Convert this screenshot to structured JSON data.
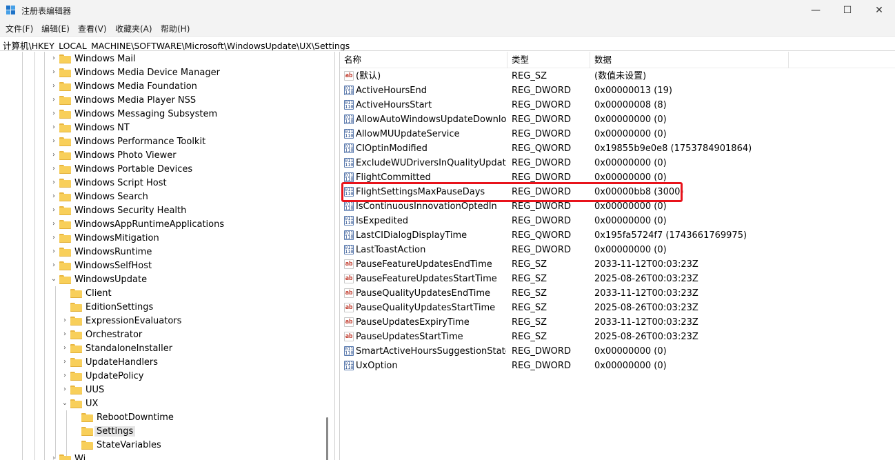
{
  "window": {
    "title": "注册表编辑器",
    "min_glyph": "—",
    "max_glyph": "☐",
    "close_glyph": "✕"
  },
  "menu": [
    "文件(F)",
    "编辑(E)",
    "查看(V)",
    "收藏夹(A)",
    "帮助(H)"
  ],
  "address": "计算机\\HKEY_LOCAL_MACHINE\\SOFTWARE\\Microsoft\\WindowsUpdate\\UX\\Settings",
  "tree": [
    {
      "label": "Windows Mail",
      "level": 0,
      "state": "collapsed"
    },
    {
      "label": "Windows Media Device Manager",
      "level": 0,
      "state": "collapsed"
    },
    {
      "label": "Windows Media Foundation",
      "level": 0,
      "state": "collapsed"
    },
    {
      "label": "Windows Media Player NSS",
      "level": 0,
      "state": "collapsed"
    },
    {
      "label": "Windows Messaging Subsystem",
      "level": 0,
      "state": "collapsed"
    },
    {
      "label": "Windows NT",
      "level": 0,
      "state": "collapsed"
    },
    {
      "label": "Windows Performance Toolkit",
      "level": 0,
      "state": "collapsed"
    },
    {
      "label": "Windows Photo Viewer",
      "level": 0,
      "state": "collapsed"
    },
    {
      "label": "Windows Portable Devices",
      "level": 0,
      "state": "collapsed"
    },
    {
      "label": "Windows Script Host",
      "level": 0,
      "state": "collapsed"
    },
    {
      "label": "Windows Search",
      "level": 0,
      "state": "collapsed"
    },
    {
      "label": "Windows Security Health",
      "level": 0,
      "state": "collapsed"
    },
    {
      "label": "WindowsAppRuntimeApplications",
      "level": 0,
      "state": "collapsed"
    },
    {
      "label": "WindowsMitigation",
      "level": 0,
      "state": "collapsed"
    },
    {
      "label": "WindowsRuntime",
      "level": 0,
      "state": "collapsed"
    },
    {
      "label": "WindowsSelfHost",
      "level": 0,
      "state": "collapsed"
    },
    {
      "label": "WindowsUpdate",
      "level": 0,
      "state": "expanded"
    },
    {
      "label": "Client",
      "level": 1,
      "state": "none"
    },
    {
      "label": "EditionSettings",
      "level": 1,
      "state": "none"
    },
    {
      "label": "ExpressionEvaluators",
      "level": 1,
      "state": "collapsed"
    },
    {
      "label": "Orchestrator",
      "level": 1,
      "state": "collapsed"
    },
    {
      "label": "StandaloneInstaller",
      "level": 1,
      "state": "collapsed"
    },
    {
      "label": "UpdateHandlers",
      "level": 1,
      "state": "collapsed"
    },
    {
      "label": "UpdatePolicy",
      "level": 1,
      "state": "collapsed"
    },
    {
      "label": "UUS",
      "level": 1,
      "state": "collapsed"
    },
    {
      "label": "UX",
      "level": 1,
      "state": "expanded"
    },
    {
      "label": "RebootDowntime",
      "level": 2,
      "state": "none"
    },
    {
      "label": "Settings",
      "level": 2,
      "state": "none",
      "selected": true
    },
    {
      "label": "StateVariables",
      "level": 2,
      "state": "none"
    },
    {
      "label": "Wi",
      "level": 0,
      "state": "collapsed"
    }
  ],
  "columns": {
    "name": "名称",
    "type": "类型",
    "data": "数据"
  },
  "values": [
    {
      "name": "(默认)",
      "type": "REG_SZ",
      "data": "(数值未设置)",
      "icon": "string"
    },
    {
      "name": "ActiveHoursEnd",
      "type": "REG_DWORD",
      "data": "0x00000013 (19)",
      "icon": "binary"
    },
    {
      "name": "ActiveHoursStart",
      "type": "REG_DWORD",
      "data": "0x00000008 (8)",
      "icon": "binary"
    },
    {
      "name": "AllowAutoWindowsUpdateDownloa...",
      "type": "REG_DWORD",
      "data": "0x00000000 (0)",
      "icon": "binary"
    },
    {
      "name": "AllowMUUpdateService",
      "type": "REG_DWORD",
      "data": "0x00000000 (0)",
      "icon": "binary"
    },
    {
      "name": "CIOptinModified",
      "type": "REG_QWORD",
      "data": "0x19855b9e0e8 (1753784901864)",
      "icon": "binary"
    },
    {
      "name": "ExcludeWUDriversInQualityUpdate",
      "type": "REG_DWORD",
      "data": "0x00000000 (0)",
      "icon": "binary"
    },
    {
      "name": "FlightCommitted",
      "type": "REG_DWORD",
      "data": "0x00000000 (0)",
      "icon": "binary"
    },
    {
      "name": "FlightSettingsMaxPauseDays",
      "type": "REG_DWORD",
      "data": "0x00000bb8 (3000)",
      "icon": "binary",
      "highlighted": true
    },
    {
      "name": "IsContinuousInnovationOptedIn",
      "type": "REG_DWORD",
      "data": "0x00000000 (0)",
      "icon": "binary"
    },
    {
      "name": "IsExpedited",
      "type": "REG_DWORD",
      "data": "0x00000000 (0)",
      "icon": "binary"
    },
    {
      "name": "LastCIDialogDisplayTime",
      "type": "REG_QWORD",
      "data": "0x195fa5724f7 (1743661769975)",
      "icon": "binary"
    },
    {
      "name": "LastToastAction",
      "type": "REG_DWORD",
      "data": "0x00000000 (0)",
      "icon": "binary"
    },
    {
      "name": "PauseFeatureUpdatesEndTime",
      "type": "REG_SZ",
      "data": "2033-11-12T00:03:23Z",
      "icon": "string"
    },
    {
      "name": "PauseFeatureUpdatesStartTime",
      "type": "REG_SZ",
      "data": "2025-08-26T00:03:23Z",
      "icon": "string"
    },
    {
      "name": "PauseQualityUpdatesEndTime",
      "type": "REG_SZ",
      "data": "2033-11-12T00:03:23Z",
      "icon": "string"
    },
    {
      "name": "PauseQualityUpdatesStartTime",
      "type": "REG_SZ",
      "data": "2025-08-26T00:03:23Z",
      "icon": "string"
    },
    {
      "name": "PauseUpdatesExpiryTime",
      "type": "REG_SZ",
      "data": "2033-11-12T00:03:23Z",
      "icon": "string"
    },
    {
      "name": "PauseUpdatesStartTime",
      "type": "REG_SZ",
      "data": "2025-08-26T00:03:23Z",
      "icon": "string"
    },
    {
      "name": "SmartActiveHoursSuggestionState",
      "type": "REG_DWORD",
      "data": "0x00000000 (0)",
      "icon": "binary"
    },
    {
      "name": "UxOption",
      "type": "REG_DWORD",
      "data": "0x00000000 (0)",
      "icon": "binary"
    }
  ],
  "icons": {
    "string": "ab",
    "binary": "011\n110"
  },
  "colors": {
    "highlight_border": "#e8131b",
    "selection": "#e5e5e5",
    "folder": "#f8cf5a"
  }
}
